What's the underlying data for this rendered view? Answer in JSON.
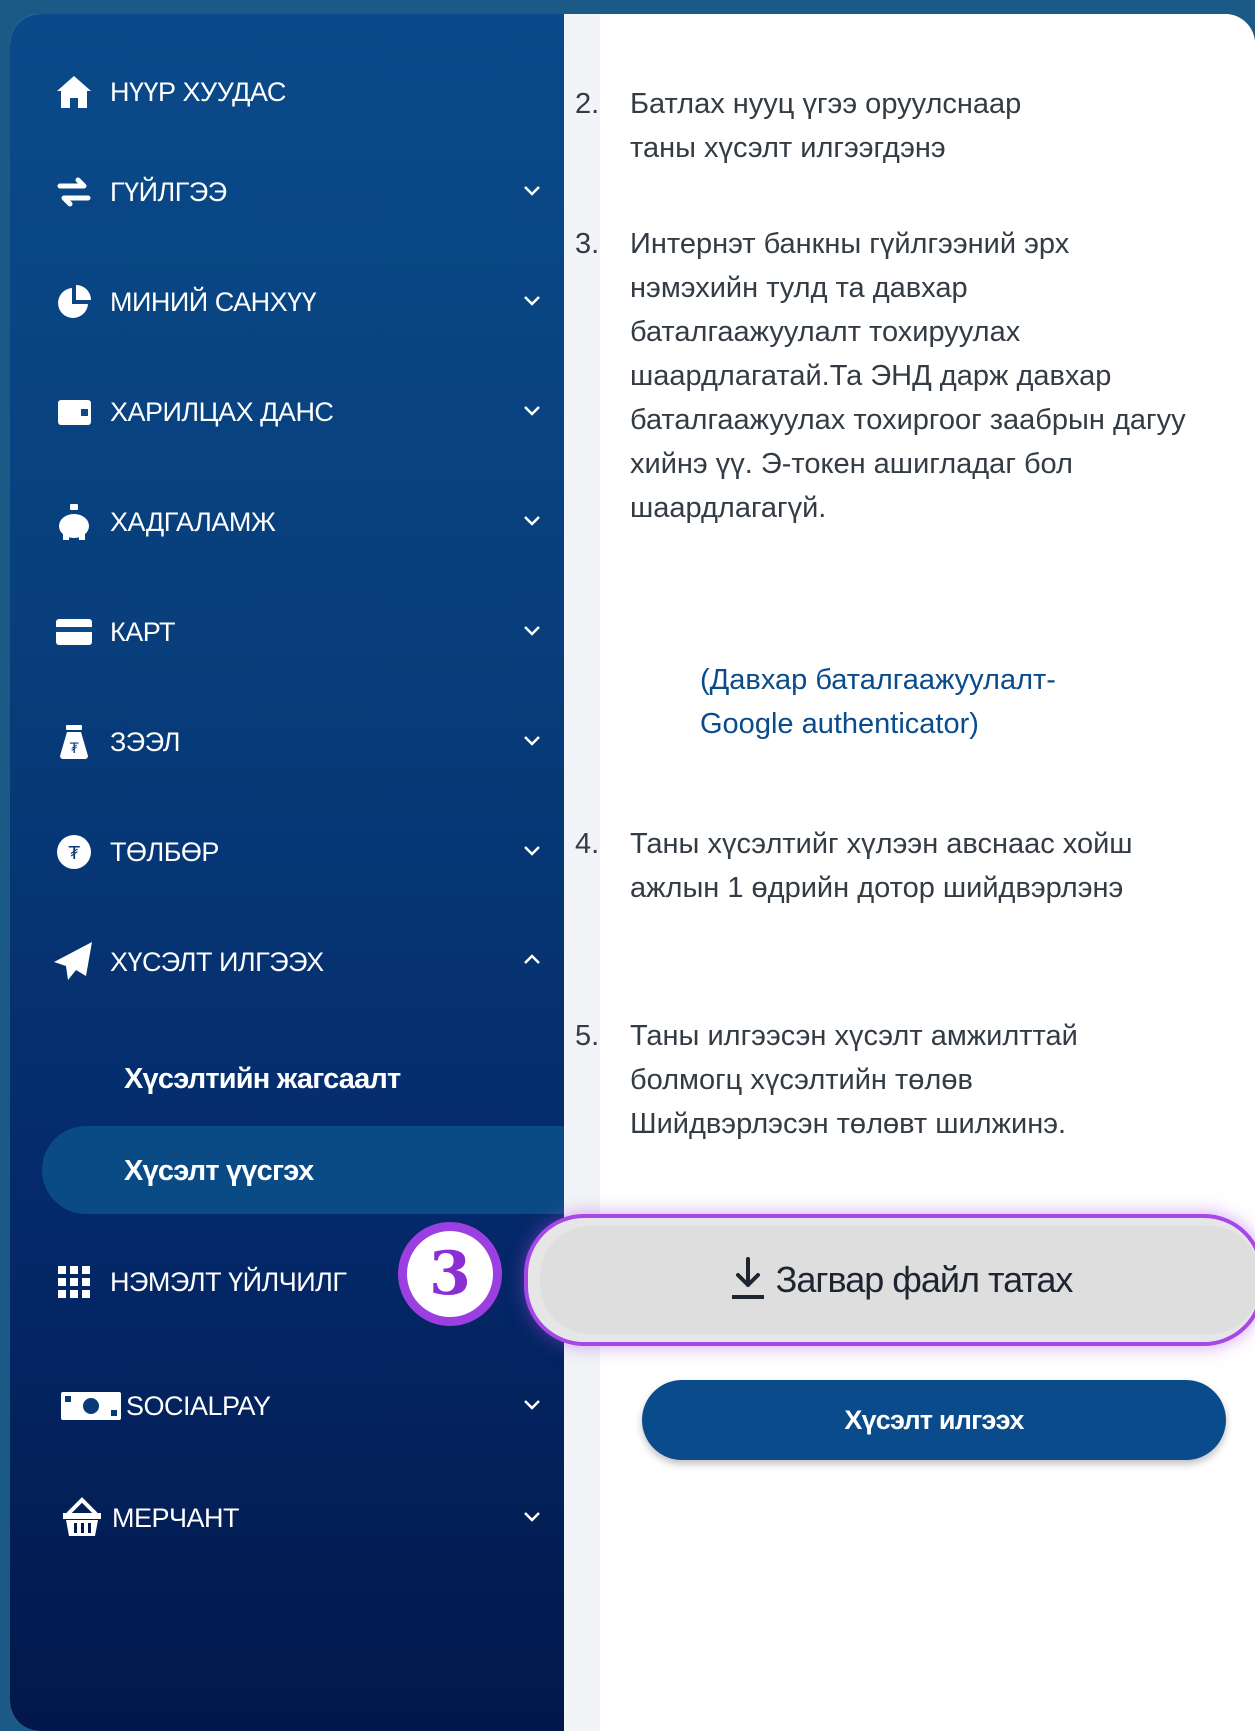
{
  "sidebar": {
    "items": [
      {
        "label": "НҮҮР ХУУДАС",
        "icon": "home-icon"
      },
      {
        "label": "ГҮЙЛГЭЭ",
        "icon": "transfer-arrows-icon"
      },
      {
        "label": "МИНИЙ САНХҮҮ",
        "icon": "pie-chart-icon"
      },
      {
        "label": "ХАРИЛЦАХ ДАНС",
        "icon": "wallet-icon"
      },
      {
        "label": "ХАДГАЛАМЖ",
        "icon": "piggy-bank-icon"
      },
      {
        "label": "КАРТ",
        "icon": "card-icon"
      },
      {
        "label": "ЗЭЭЛ",
        "icon": "money-bag-icon"
      },
      {
        "label": "ТӨЛБӨР",
        "icon": "coin-icon"
      },
      {
        "label": "ХҮСЭЛТ ИЛГЭЭХ",
        "icon": "paper-plane-icon"
      },
      {
        "label": "НЭМЭЛТ ҮЙЛЧИЛГ",
        "icon": "grid-icon"
      },
      {
        "label": "SOCIALPAY",
        "icon": "cash-icon"
      },
      {
        "label": "МЕРЧАНТ",
        "icon": "basket-icon"
      }
    ],
    "sub_items": [
      {
        "label": "Хүсэлтийн жагсаалт"
      },
      {
        "label": "Хүсэлт үүсгэх"
      }
    ]
  },
  "content": {
    "steps": [
      {
        "num": "2.",
        "text": "Батлах нууц үгээ оруулснаар таны хүсэлт илгээгдэнэ"
      },
      {
        "num": "3.",
        "text": "Интернэт банкны гүйлгээний эрх нэмэхийн тулд та давхар баталгаажуулалт тохируулах шаардлагатай.Та ЭНД дарж давхар баталгаажуулах тохиргоог заабрын дагуу хийнэ үү. Э-токен ашигладаг бол шаардлагагүй."
      },
      {
        "num": "4.",
        "text": "Таны хүсэлтийг хүлээн авснаас хойш ажлын 1 өдрийн дотор шийдвэрлэнэ"
      },
      {
        "num": "5.",
        "text": "Таны илгээсэн хүсэлт амжилттай болмогц хүсэлтийн төлөв Шийдвэрлэсэн төлөвт шилжинэ."
      }
    ],
    "link_note": "(Давхар баталгаажуулалт-Google authenticator)",
    "download_label": "Загвар файл татах",
    "submit_label": "Хүсэлт илгээх",
    "badge": "3"
  },
  "colors": {
    "accent": "#0a4b8c",
    "highlight": "#a548e6"
  }
}
